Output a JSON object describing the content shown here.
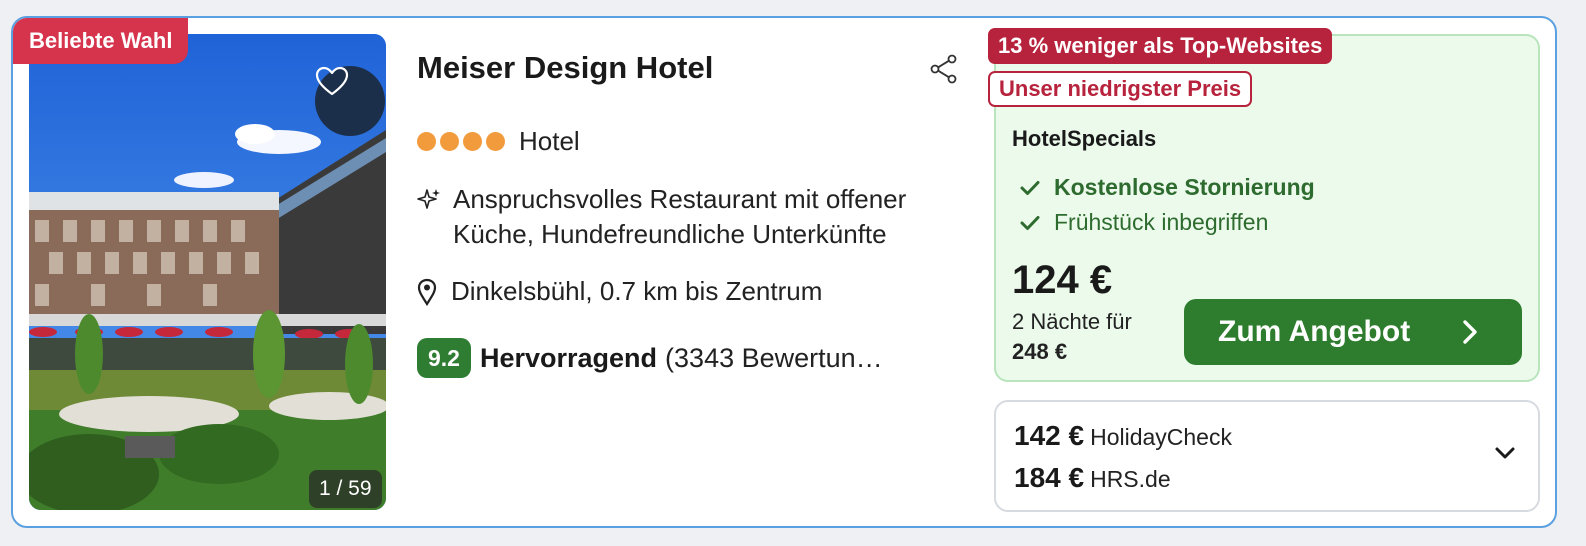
{
  "listing": {
    "badge": "Beliebte Wahl",
    "gallery_counter": "1 / 59",
    "hotel_name": "Meiser Design Hotel",
    "star_count": 4,
    "property_type": "Hotel",
    "features": "Anspruchsvolles Restaurant mit offener Küche, Hundefreundliche Unterkünfte",
    "location": "Dinkelsbühl, 0.7 km bis Zentrum",
    "rating_score": "9.2",
    "rating_label": "Hervorragend",
    "rating_count": "(3343 Bewertun…"
  },
  "deal": {
    "savings_badge": "13 % weniger als Top-Websites",
    "lowest_badge": "Unser niedrigster Preis",
    "provider": "HotelSpecials",
    "perks": [
      "Kostenlose Stornierung",
      "Frühstück inbegriffen"
    ],
    "price": "124 €",
    "nights_label": "2 Nächte für",
    "total": "248 €",
    "cta_label": "Zum Angebot"
  },
  "other_offers": [
    {
      "price": "142 €",
      "provider": "HolidayCheck"
    },
    {
      "price": "184 €",
      "provider": "HRS.de"
    }
  ],
  "colors": {
    "ribbon": "#d6334d",
    "badge": "#b7233c",
    "star": "#f29b3d",
    "score": "#2e7d32",
    "cta": "#2e7d2e",
    "deal_bg": "#ecfaec",
    "border": "#5aa0e0"
  },
  "icons": {
    "favorite": "heart-icon",
    "share": "share-icon",
    "feature": "sparkle-icon",
    "location": "map-pin-icon",
    "perk": "check-icon",
    "cta": "chevron-right-icon",
    "expand": "chevron-down-icon"
  }
}
